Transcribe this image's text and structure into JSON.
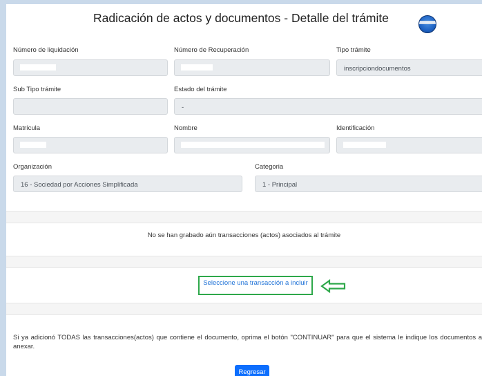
{
  "title": "Radicación de actos y documentos - Detalle del trámite",
  "fields": {
    "numero_liquidacion": {
      "label": "Número de liquidación",
      "value": ""
    },
    "numero_recuperacion": {
      "label": "Número de Recuperación",
      "value": ""
    },
    "tipo_tramite": {
      "label": "Tipo trámite",
      "value": "inscripciondocumentos"
    },
    "sub_tipo_tramite": {
      "label": "Sub Tipo trámite",
      "value": ""
    },
    "estado_tramite": {
      "label": "Estado del trámite",
      "value": "-"
    },
    "matricula": {
      "label": "Matrícula",
      "value": ""
    },
    "nombre": {
      "label": "Nombre",
      "value": ""
    },
    "identificacion": {
      "label": "Identificación",
      "value": ""
    },
    "organizacion": {
      "label": "Organización",
      "value": "16 - Sociedad por Acciones Simplificada"
    },
    "categoria": {
      "label": "Categoria",
      "value": "1 - Principal"
    }
  },
  "no_transactions_text": "No se han grabado aún transacciones (actos) asociados al trámite",
  "select_transaction_link": "Seleccione una transacción a incluir",
  "footer_note": "Si ya adicionó TODAS las transacciones(actos) que contiene el documento, oprima el botón \"CONTINUAR\" para que el sistema le indique los documentos a anexar.",
  "back_button": "Regresar",
  "colors": {
    "highlight": "#2ea84a",
    "link": "#1a6fd6",
    "button": "#0d6efd",
    "field_bg": "#e9ecef",
    "outer_bg": "#c9d9ea"
  },
  "icons": {
    "logo": "logo-badge-icon",
    "arrow": "left-arrow-icon"
  }
}
